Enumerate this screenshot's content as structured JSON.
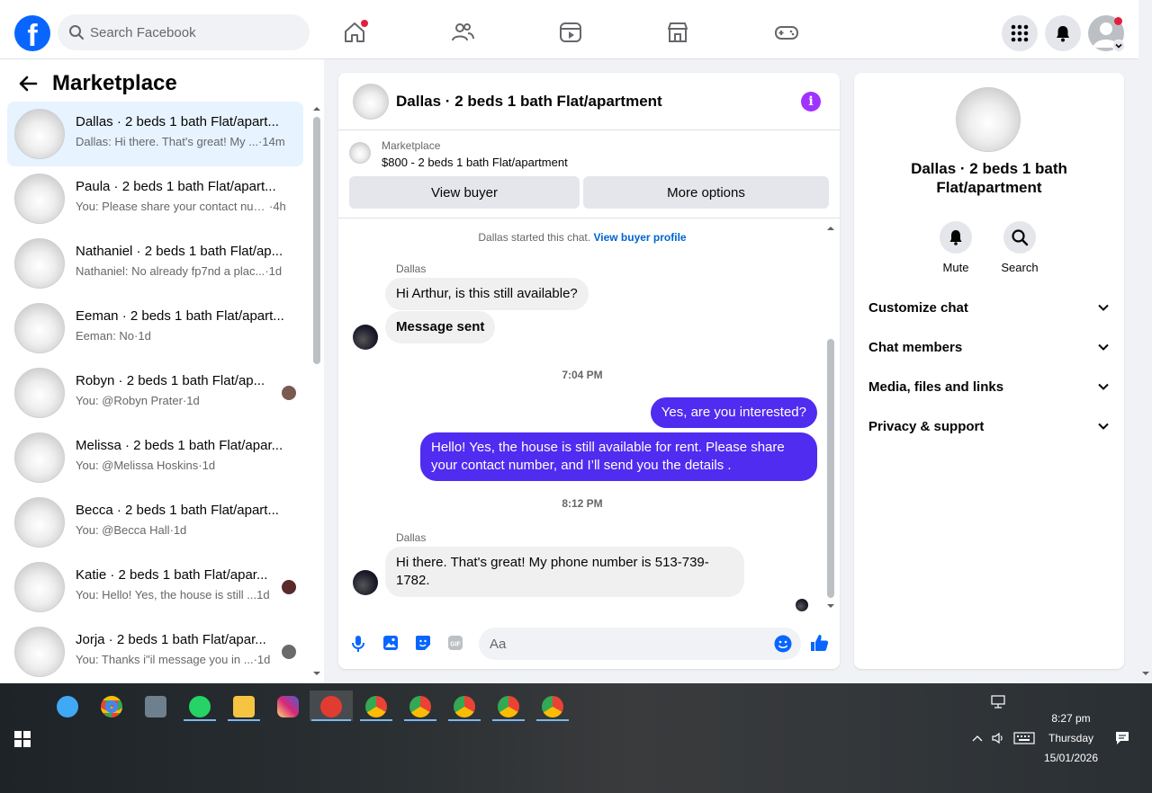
{
  "topbar": {
    "logo": "f",
    "search_placeholder": "Search Facebook",
    "nav_icons": [
      "home-icon",
      "friends-icon",
      "video-icon",
      "marketplace-icon",
      "gaming-icon"
    ],
    "right_icons": [
      "menu-grid-icon",
      "bell-icon",
      "profile-avatar"
    ],
    "brand_color": "#0866ff"
  },
  "left": {
    "title": "Marketplace",
    "conversations": [
      {
        "name": "Dallas · 2 beds 1 bath Flat/apart...",
        "preview": "Dallas: Hi there. That's great! My ...",
        "time": "·14m",
        "active": true
      },
      {
        "name": "Paula · 2 beds 1 bath Flat/apart...",
        "preview": "You: Please share your contact num...",
        "time": "·4h"
      },
      {
        "name": "Nathaniel · 2 beds 1 bath Flat/ap...",
        "preview": "Nathaniel: No already fp7nd a plac...",
        "time": "·1d"
      },
      {
        "name": "Eeman · 2 beds 1 bath Flat/apart...",
        "preview": "Eeman: No",
        "time": "·1d"
      },
      {
        "name": "Robyn · 2 beds 1 bath Flat/ap...",
        "preview": "You: @Robyn Prater",
        "time": "·1d"
      },
      {
        "name": "Melissa · 2 beds 1 bath Flat/apar...",
        "preview": "You: @Melissa Hoskins",
        "time": "·1d"
      },
      {
        "name": "Becca · 2 beds 1 bath Flat/apart...",
        "preview": "You: @Becca Hall",
        "time": "·1d"
      },
      {
        "name": "Katie · 2 beds 1 bath Flat/apar...",
        "preview": "You: Hello! Yes, the house is still ...",
        "time": "1d"
      },
      {
        "name": "Jorja · 2 beds 1 bath Flat/apar...",
        "preview": "You: Thanks i\"il message you in ...",
        "time": "·1d"
      }
    ]
  },
  "chat": {
    "title": "Dallas · 2 beds 1 bath Flat/apartment",
    "listing_source": "Marketplace",
    "listing_price": "$800 - 2 beds 1 bath Flat/apartment",
    "view_buyer": "View buyer",
    "more_options": "More options",
    "system_text": "Dallas started this chat.",
    "system_link": "View buyer profile",
    "sender1": "Dallas",
    "msg1": "Hi Arthur, is this still available?",
    "msg2": "Message sent",
    "time1": "7:04 PM",
    "out1": "Yes, are you interested?",
    "out2": "Hello! Yes, the house is still available for rent. Please share your contact number, and I’ll send you the details .",
    "time2": "8:12 PM",
    "sender2": "Dallas",
    "msg3": "Hi there. That's great! My phone number is 513-739-1782.",
    "composer_placeholder": "Aa",
    "accent_color": "#4f2cf0"
  },
  "right": {
    "title": "Dallas · 2 beds 1 bath Flat/apartment",
    "mute": "Mute",
    "search": "Search",
    "sections": [
      "Customize chat",
      "Chat members",
      "Media, files and links",
      "Privacy & support"
    ]
  },
  "taskbar": {
    "time": "8:27 pm",
    "day": "Thursday",
    "date": "15/01/2026"
  }
}
